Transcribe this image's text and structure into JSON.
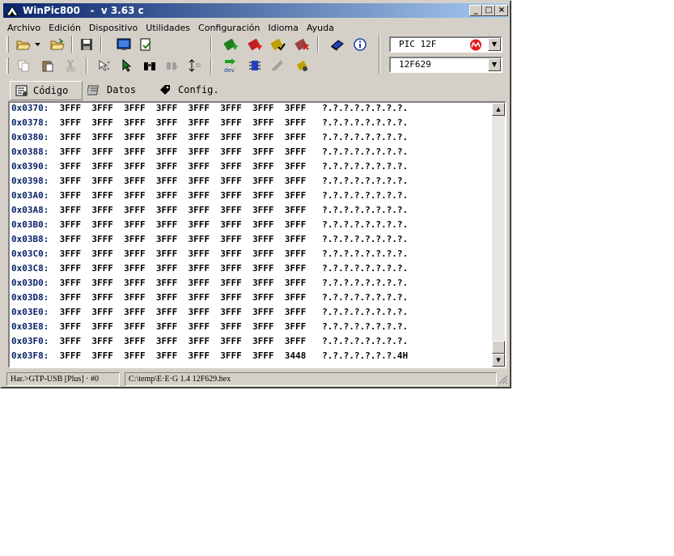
{
  "window": {
    "title": "WinPic800   -  v 3.63 c",
    "minimize": "_",
    "maximize": "□",
    "close": "×"
  },
  "menu": [
    "Archivo",
    "Edición",
    "Dispositivo",
    "Utilidades",
    "Configuración",
    "Idioma",
    "Ayuda"
  ],
  "device": {
    "family": "PIC 12F",
    "model": "12F629"
  },
  "tabs": {
    "code": "Código",
    "data": "Datos",
    "config": "Config."
  },
  "code_rows": [
    {
      "addr": "0x0370:",
      "words": "3FFF  3FFF  3FFF  3FFF  3FFF  3FFF  3FFF  3FFF",
      "ascii": "?.?.?.?.?.?.?.?."
    },
    {
      "addr": "0x0378:",
      "words": "3FFF  3FFF  3FFF  3FFF  3FFF  3FFF  3FFF  3FFF",
      "ascii": "?.?.?.?.?.?.?.?."
    },
    {
      "addr": "0x0380:",
      "words": "3FFF  3FFF  3FFF  3FFF  3FFF  3FFF  3FFF  3FFF",
      "ascii": "?.?.?.?.?.?.?.?."
    },
    {
      "addr": "0x0388:",
      "words": "3FFF  3FFF  3FFF  3FFF  3FFF  3FFF  3FFF  3FFF",
      "ascii": "?.?.?.?.?.?.?.?."
    },
    {
      "addr": "0x0390:",
      "words": "3FFF  3FFF  3FFF  3FFF  3FFF  3FFF  3FFF  3FFF",
      "ascii": "?.?.?.?.?.?.?.?."
    },
    {
      "addr": "0x0398:",
      "words": "3FFF  3FFF  3FFF  3FFF  3FFF  3FFF  3FFF  3FFF",
      "ascii": "?.?.?.?.?.?.?.?."
    },
    {
      "addr": "0x03A0:",
      "words": "3FFF  3FFF  3FFF  3FFF  3FFF  3FFF  3FFF  3FFF",
      "ascii": "?.?.?.?.?.?.?.?."
    },
    {
      "addr": "0x03A8:",
      "words": "3FFF  3FFF  3FFF  3FFF  3FFF  3FFF  3FFF  3FFF",
      "ascii": "?.?.?.?.?.?.?.?."
    },
    {
      "addr": "0x03B0:",
      "words": "3FFF  3FFF  3FFF  3FFF  3FFF  3FFF  3FFF  3FFF",
      "ascii": "?.?.?.?.?.?.?.?."
    },
    {
      "addr": "0x03B8:",
      "words": "3FFF  3FFF  3FFF  3FFF  3FFF  3FFF  3FFF  3FFF",
      "ascii": "?.?.?.?.?.?.?.?."
    },
    {
      "addr": "0x03C0:",
      "words": "3FFF  3FFF  3FFF  3FFF  3FFF  3FFF  3FFF  3FFF",
      "ascii": "?.?.?.?.?.?.?.?."
    },
    {
      "addr": "0x03C8:",
      "words": "3FFF  3FFF  3FFF  3FFF  3FFF  3FFF  3FFF  3FFF",
      "ascii": "?.?.?.?.?.?.?.?."
    },
    {
      "addr": "0x03D0:",
      "words": "3FFF  3FFF  3FFF  3FFF  3FFF  3FFF  3FFF  3FFF",
      "ascii": "?.?.?.?.?.?.?.?."
    },
    {
      "addr": "0x03D8:",
      "words": "3FFF  3FFF  3FFF  3FFF  3FFF  3FFF  3FFF  3FFF",
      "ascii": "?.?.?.?.?.?.?.?."
    },
    {
      "addr": "0x03E0:",
      "words": "3FFF  3FFF  3FFF  3FFF  3FFF  3FFF  3FFF  3FFF",
      "ascii": "?.?.?.?.?.?.?.?."
    },
    {
      "addr": "0x03E8:",
      "words": "3FFF  3FFF  3FFF  3FFF  3FFF  3FFF  3FFF  3FFF",
      "ascii": "?.?.?.?.?.?.?.?."
    },
    {
      "addr": "0x03F0:",
      "words": "3FFF  3FFF  3FFF  3FFF  3FFF  3FFF  3FFF  3FFF",
      "ascii": "?.?.?.?.?.?.?.?."
    },
    {
      "addr": "0x03F8:",
      "words": "3FFF  3FFF  3FFF  3FFF  3FFF  3FFF  3FFF  3448",
      "ascii": "?.?.?.?.?.?.?.4H"
    }
  ],
  "status": {
    "hardware": "Har.>GTP-USB [Plus] · #0",
    "file": "C:\\temp\\E·E·G 1.4 12F629.hex"
  },
  "colors": {
    "title_start": "#0a246a",
    "title_end": "#a6caf0",
    "face": "#d4d0c8",
    "address": "#0a246a"
  }
}
